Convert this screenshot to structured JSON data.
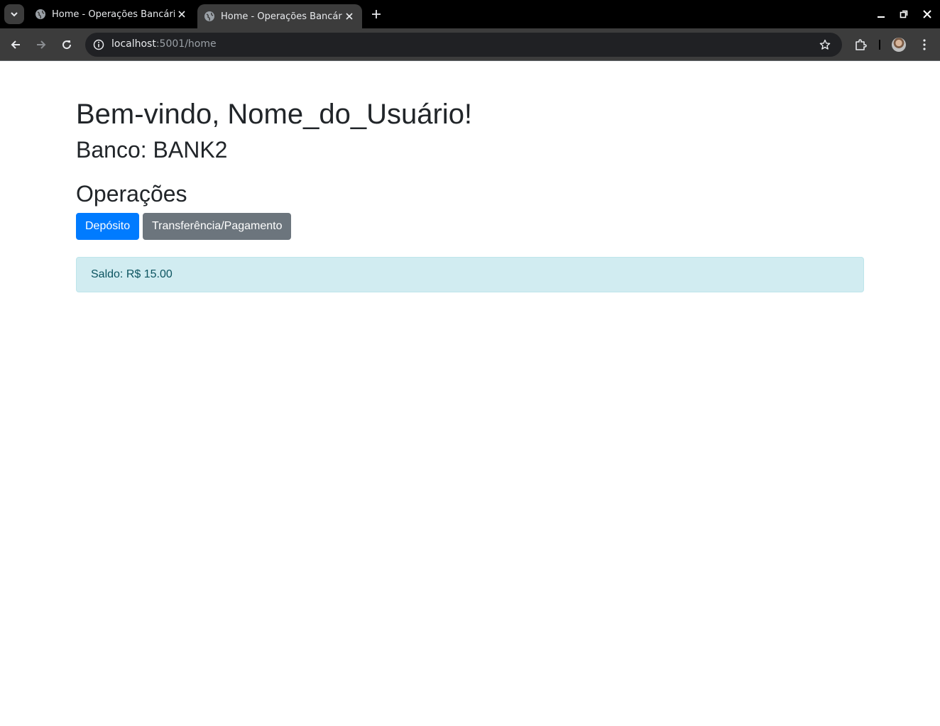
{
  "browser": {
    "tabs": [
      {
        "title": "Home - Operações Bancárias",
        "active": false,
        "favicon": "globe-icon"
      },
      {
        "title": "Home - Operações Bancárias",
        "active": true,
        "favicon": "globe-icon"
      }
    ],
    "address": {
      "host": "localhost",
      "rest": ":5001/home"
    },
    "icons": {
      "tab_search": "chevron-down-icon",
      "new_tab": "plus-icon",
      "back": "arrow-left-icon",
      "forward": "arrow-right-icon",
      "reload": "reload-icon",
      "site_info": "info-icon",
      "bookmark": "star-icon",
      "extensions": "puzzle-icon",
      "menu": "kebab-menu-icon"
    },
    "colors": {
      "tabstrip": "#000000",
      "toolbar": "#3c3c3c",
      "omnibox": "#202124"
    }
  },
  "page": {
    "welcome": "Bem-vindo, Nome_do_Usuário!",
    "bank": "Banco: BANK2",
    "operations_title": "Operações",
    "buttons": {
      "deposit": "Depósito",
      "transfer": "Transferência/Pagamento"
    },
    "balance": "Saldo: R$ 15.00",
    "colors": {
      "primary": "#007bff",
      "secondary": "#6c757d",
      "info_bg": "#d1ecf1",
      "info_text": "#0c5460"
    }
  }
}
